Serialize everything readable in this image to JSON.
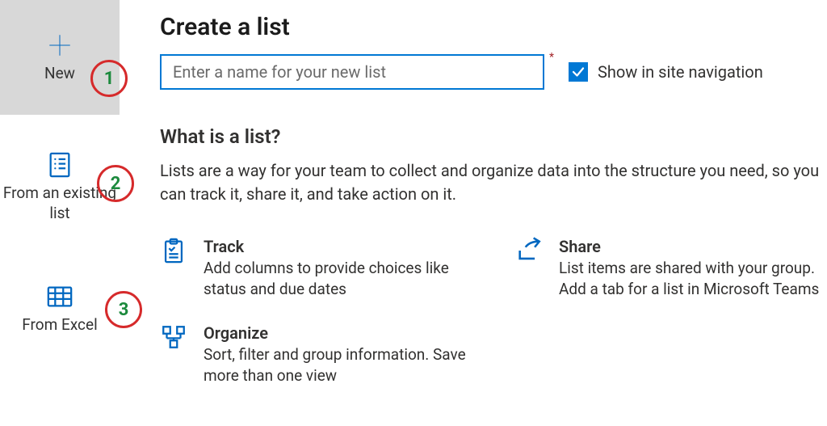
{
  "sidebar": {
    "new_label": "New",
    "existing_label": "From an existing list",
    "excel_label": "From Excel"
  },
  "annotations": {
    "a1": "1",
    "a2": "2",
    "a3": "3"
  },
  "header": {
    "title": "Create a list"
  },
  "form": {
    "name_placeholder": "Enter a name for your new list",
    "required_mark": "*",
    "show_nav_label": "Show in site navigation",
    "show_nav_checked": true
  },
  "info": {
    "heading": "What is a list?",
    "description": "Lists are a way for your team to collect and organize data into the structure you need, so you can track it, share it, and take action on it."
  },
  "features": {
    "track": {
      "title": "Track",
      "desc": "Add columns to provide choices like status and due dates"
    },
    "share": {
      "title": "Share",
      "desc": "List items are shared with your group. Add a tab for a list in Microsoft Teams"
    },
    "organize": {
      "title": "Organize",
      "desc": "Sort, filter and group information. Save more than one view"
    }
  }
}
